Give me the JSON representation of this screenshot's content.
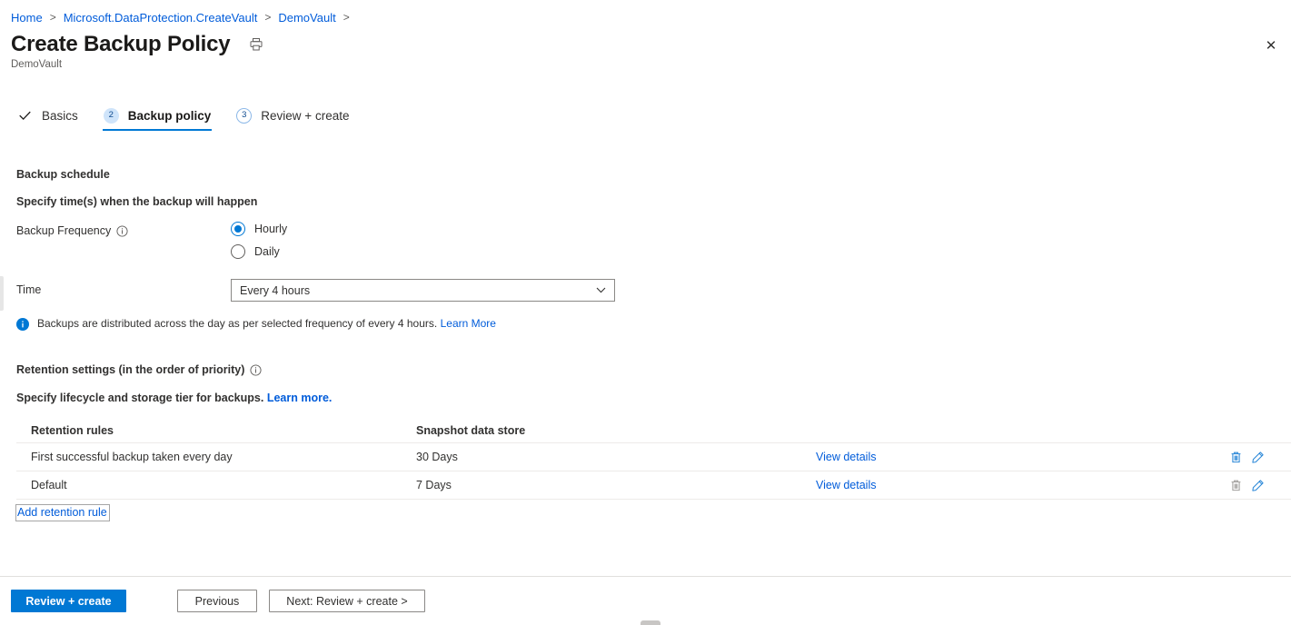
{
  "breadcrumb": {
    "items": [
      {
        "label": "Home"
      },
      {
        "label": "Microsoft.DataProtection.CreateVault"
      },
      {
        "label": "DemoVault"
      }
    ],
    "separator": ">"
  },
  "header": {
    "title": "Create Backup Policy",
    "subtitle": "DemoVault",
    "print_icon": "printer-icon",
    "close_icon": "close-icon",
    "close_glyph": "✕"
  },
  "tabs": [
    {
      "label": "Basics",
      "marker": "check",
      "glyph": "✓",
      "state": "completed"
    },
    {
      "label": "Backup policy",
      "marker": "number",
      "glyph": "2",
      "state": "active"
    },
    {
      "label": "Review + create",
      "marker": "number",
      "glyph": "3",
      "state": "upcoming"
    }
  ],
  "schedule": {
    "heading": "Backup schedule",
    "description": "Specify time(s) when the backup will happen",
    "frequency_label": "Backup Frequency",
    "frequency_info_icon": "info-icon",
    "frequency_options": [
      {
        "label": "Hourly",
        "selected": true
      },
      {
        "label": "Daily",
        "selected": false
      }
    ],
    "time_label": "Time",
    "time_value": "Every 4 hours",
    "time_chevron_icon": "chevron-down-icon",
    "info_icon": "info-filled-icon",
    "info_text": "Backups are distributed across the day as per selected frequency of every 4 hours.",
    "info_link": "Learn More"
  },
  "retention": {
    "heading": "Retention settings (in the order of priority)",
    "heading_info_icon": "info-icon",
    "description": "Specify lifecycle and storage tier for backups.",
    "description_link": "Learn more.",
    "columns": {
      "rule": "Retention rules",
      "store": "Snapshot data store",
      "view": "",
      "actions": ""
    },
    "rows": [
      {
        "rule": "First successful backup taken every day",
        "store": "30 Days",
        "view_label": "View details",
        "delete_icon": "trash-icon",
        "delete_enabled": true,
        "edit_icon": "pencil-icon",
        "edit_enabled": true
      },
      {
        "rule": "Default",
        "store": "7 Days",
        "view_label": "View details",
        "delete_icon": "trash-icon",
        "delete_enabled": false,
        "edit_icon": "pencil-icon",
        "edit_enabled": true
      }
    ],
    "add_link": "Add retention rule"
  },
  "footer": {
    "review_create": "Review + create",
    "previous": "Previous",
    "next": "Next: Review + create >"
  },
  "colors": {
    "accent": "#0078d4",
    "link": "#015cda",
    "text": "#323130",
    "border": "#edebe9",
    "disabled_icon": "#a19f9d"
  }
}
